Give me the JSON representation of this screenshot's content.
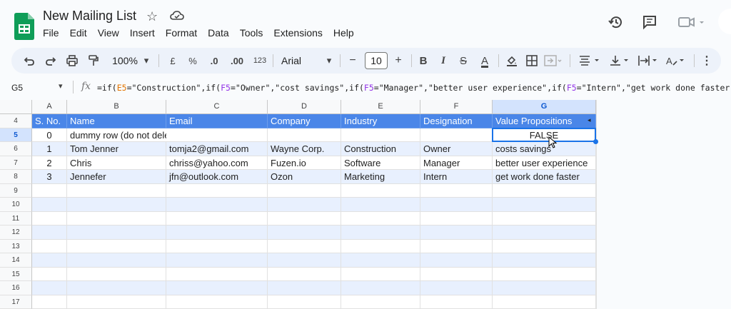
{
  "app": {
    "title": "New Mailing List",
    "colors": {
      "brand": "#0f9d58",
      "accent": "#1a73e8",
      "header_fill": "#4a86e8"
    }
  },
  "menu": [
    "File",
    "Edit",
    "View",
    "Insert",
    "Format",
    "Data",
    "Tools",
    "Extensions",
    "Help"
  ],
  "header_icons": [
    "star-icon",
    "cloud-icon",
    "history-icon",
    "comment-icon",
    "video-icon"
  ],
  "toolbar": {
    "zoom": "100%",
    "currency": "£",
    "percent": "%",
    "dec_decrease": ".0",
    "dec_increase": ".00",
    "format_number": "123",
    "font": "Arial",
    "font_size": "10",
    "bold": "B",
    "italic": "I",
    "strike": "S",
    "text_color": "A",
    "font_minus": "−",
    "font_plus": "+"
  },
  "formula_bar": {
    "cell_ref": "G5",
    "fx": "fx",
    "parts": [
      {
        "t": "=if(",
        "c": "#1f1f1f"
      },
      {
        "t": "E5",
        "c": "#e37400"
      },
      {
        "t": "=\"Construction\",if(",
        "c": "#1f1f1f"
      },
      {
        "t": "F5",
        "c": "#9334e6"
      },
      {
        "t": "=\"Owner\",\"cost savings\",if(",
        "c": "#1f1f1f"
      },
      {
        "t": "F5",
        "c": "#9334e6"
      },
      {
        "t": "=\"Manager\",\"better user experience\",if(",
        "c": "#1f1f1f"
      },
      {
        "t": "F5",
        "c": "#9334e6"
      },
      {
        "t": "=\"Intern\",\"get work done faster\")",
        "c": "#1f1f1f"
      }
    ]
  },
  "columns": [
    "A",
    "B",
    "C",
    "D",
    "E",
    "F",
    "G"
  ],
  "rows": [
    {
      "num": "4",
      "cells": [
        "S. No.",
        "Name",
        "Email",
        "Company",
        "Industry",
        "Designation",
        "Value Propositions"
      ]
    },
    {
      "num": "5",
      "cells": [
        "0",
        "dummy row (do not delete)",
        "",
        "",
        "",
        "",
        "FALSE"
      ]
    },
    {
      "num": "6",
      "cells": [
        "1",
        "Tom Jenner",
        "tomja2@gmail.com",
        "Wayne Corp.",
        "Construction",
        "Owner",
        "costs savings"
      ]
    },
    {
      "num": "7",
      "cells": [
        "2",
        "Chris",
        "chriss@yahoo.com",
        "Fuzen.io",
        "Software",
        "Manager",
        "better user experience"
      ]
    },
    {
      "num": "8",
      "cells": [
        "3",
        "Jennefer",
        "jfn@outlook.com",
        "Ozon",
        "Marketing",
        "Intern",
        "get work done faster"
      ]
    },
    {
      "num": "9",
      "cells": [
        "",
        "",
        "",
        "",
        "",
        "",
        ""
      ]
    },
    {
      "num": "10",
      "cells": [
        "",
        "",
        "",
        "",
        "",
        "",
        ""
      ]
    },
    {
      "num": "11",
      "cells": [
        "",
        "",
        "",
        "",
        "",
        "",
        ""
      ]
    },
    {
      "num": "12",
      "cells": [
        "",
        "",
        "",
        "",
        "",
        "",
        ""
      ]
    },
    {
      "num": "13",
      "cells": [
        "",
        "",
        "",
        "",
        "",
        "",
        ""
      ]
    },
    {
      "num": "14",
      "cells": [
        "",
        "",
        "",
        "",
        "",
        "",
        ""
      ]
    },
    {
      "num": "15",
      "cells": [
        "",
        "",
        "",
        "",
        "",
        "",
        ""
      ]
    },
    {
      "num": "16",
      "cells": [
        "",
        "",
        "",
        "",
        "",
        "",
        ""
      ]
    },
    {
      "num": "17",
      "cells": [
        "",
        "",
        "",
        "",
        "",
        "",
        ""
      ]
    }
  ],
  "selected_cell": "G5"
}
